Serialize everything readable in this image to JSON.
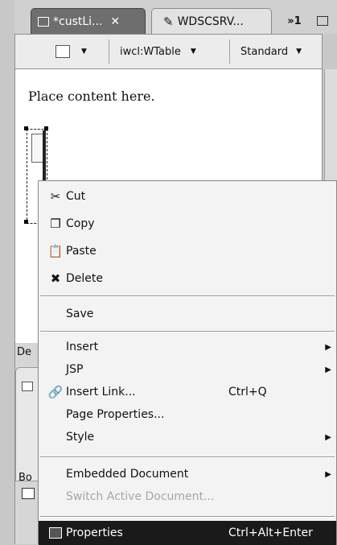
{
  "tabs": [
    {
      "label": "*custLi...",
      "close": "✕"
    },
    {
      "label": "WDSCSRV..."
    }
  ],
  "tab_overflow": "»1",
  "toolbar": {
    "tag_select": "iwcl:WTable",
    "style_select": "Standard"
  },
  "editor": {
    "placeholder_text": "Place content here."
  },
  "bottom_panel": {
    "tab_fragment_1": "De",
    "tab_fragment_2": "Bo"
  },
  "context_menu": {
    "items": [
      {
        "label": "Cut",
        "icon": "scissors-icon"
      },
      {
        "label": "Copy",
        "icon": "copy-icon"
      },
      {
        "label": "Paste",
        "icon": "paste-icon"
      },
      {
        "label": "Delete",
        "icon": "delete-icon"
      },
      {
        "label": "Save"
      },
      {
        "label": "Insert",
        "submenu": true
      },
      {
        "label": "JSP",
        "submenu": true
      },
      {
        "label": "Insert Link...",
        "shortcut": "Ctrl+Q",
        "icon": "link-icon"
      },
      {
        "label": "Page Properties..."
      },
      {
        "label": "Style",
        "submenu": true
      },
      {
        "label": "Embedded Document",
        "submenu": true
      },
      {
        "label": "Switch Active Document...",
        "disabled": true
      },
      {
        "label": "Properties",
        "shortcut": "Ctrl+Alt+Enter",
        "icon": "properties-icon",
        "selected": true
      }
    ]
  }
}
